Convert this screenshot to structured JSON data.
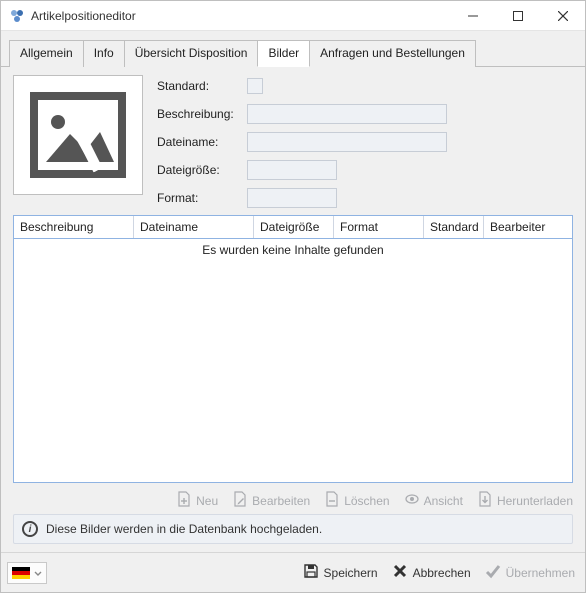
{
  "window": {
    "title": "Artikelpositioneditor"
  },
  "tabs": {
    "allgemein": "Allgemein",
    "info": "Info",
    "uebersicht": "Übersicht Disposition",
    "bilder": "Bilder",
    "anfragen": "Anfragen und Bestellungen"
  },
  "fields": {
    "standard_label": "Standard:",
    "beschreibung_label": "Beschreibung:",
    "dateiname_label": "Dateiname:",
    "dateigroesse_label": "Dateigröße:",
    "format_label": "Format:",
    "beschreibung_value": "",
    "dateiname_value": "",
    "dateigroesse_value": "",
    "format_value": ""
  },
  "table": {
    "headers": {
      "beschreibung": "Beschreibung",
      "dateiname": "Dateiname",
      "dateigroesse": "Dateigröße",
      "format": "Format",
      "standard": "Standard",
      "bearbeiter": "Bearbeiter"
    },
    "empty_message": "Es wurden keine Inhalte gefunden"
  },
  "toolbar": {
    "neu": "Neu",
    "bearbeiten": "Bearbeiten",
    "loeschen": "Löschen",
    "ansicht": "Ansicht",
    "herunterladen": "Herunterladen"
  },
  "info": {
    "text": "Diese Bilder werden in die Datenbank hochgeladen."
  },
  "bottom": {
    "speichern": "Speichern",
    "abbrechen": "Abbrechen",
    "uebernehmen": "Übernehmen"
  }
}
